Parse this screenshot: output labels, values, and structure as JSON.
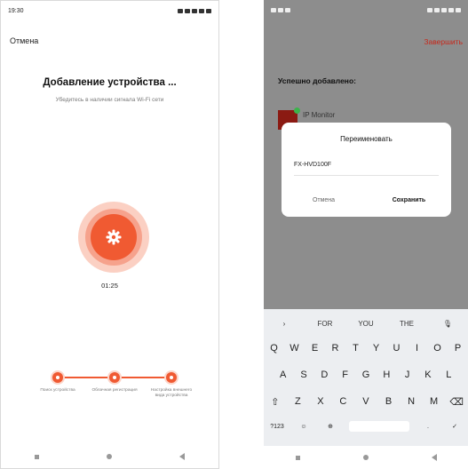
{
  "phone1": {
    "status_time": "19:30",
    "cancel_label": "Отмена",
    "title": "Добавление устройства ...",
    "subtitle": "Убедитесь в наличии сигнала Wi-Fi сети",
    "timer": "01:25",
    "steps": [
      "Поиск устройства",
      "Облачная регистрация",
      "Настройка внешнего вида устройства"
    ],
    "accent_color": "#f05a32"
  },
  "phone2": {
    "finish_label": "Завершить",
    "success_label": "Успешно добавлено:",
    "device_name": "IP Monitor"
  },
  "dialog": {
    "title": "Переименовать",
    "input_value": "FX-HVD100F",
    "cancel_label": "Отмена",
    "save_label": "Сохранить"
  },
  "keyboard": {
    "suggestions": [
      "FOR",
      "YOU",
      "THE"
    ],
    "row1": [
      "Q",
      "W",
      "E",
      "R",
      "T",
      "Y",
      "U",
      "I",
      "O",
      "P"
    ],
    "row2": [
      "A",
      "S",
      "D",
      "F",
      "G",
      "H",
      "J",
      "K",
      "L"
    ],
    "row3": [
      "Z",
      "X",
      "C",
      "V",
      "B",
      "N",
      "M"
    ],
    "numbers_key": "?123"
  }
}
